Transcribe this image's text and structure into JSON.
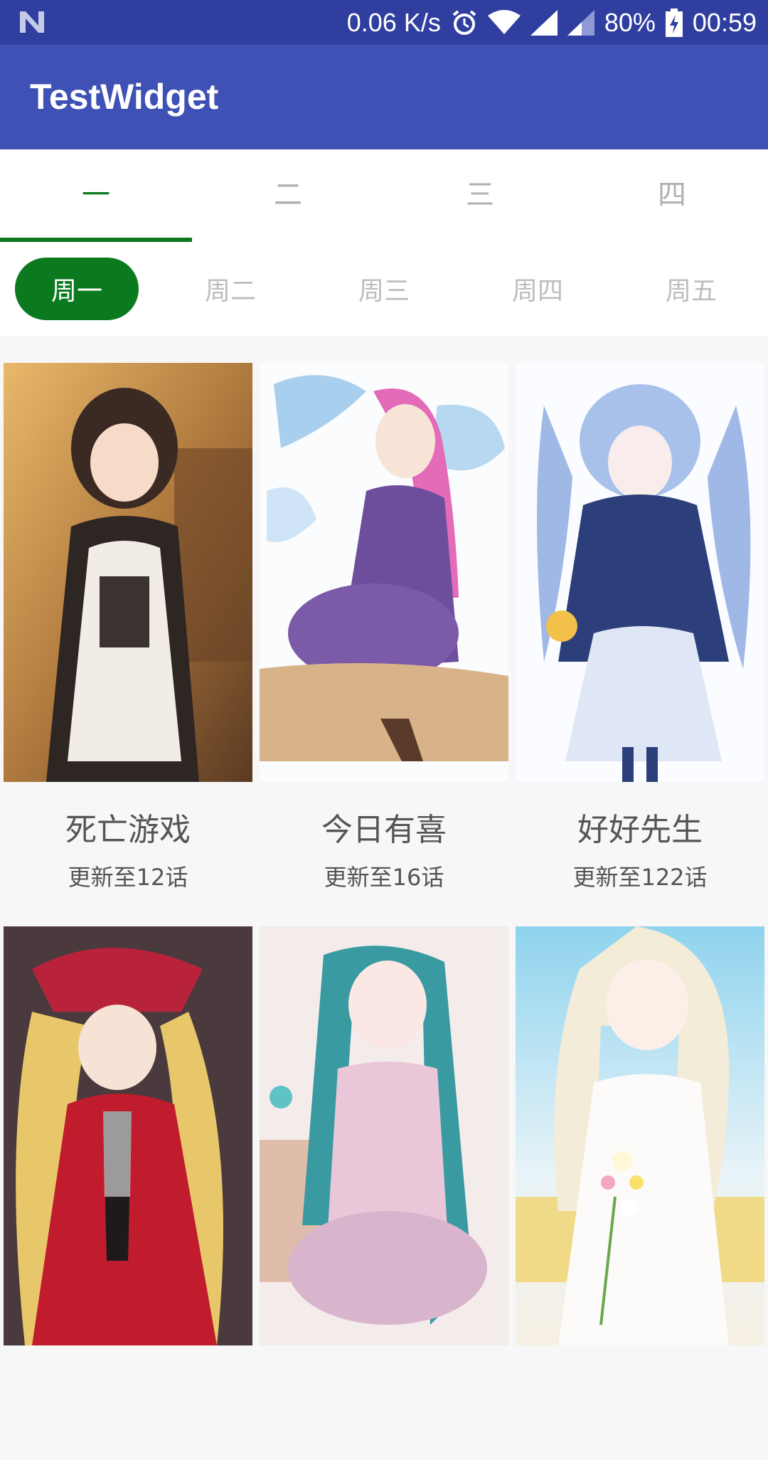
{
  "status_bar": {
    "speed": "0.06 K/s",
    "battery": "80%",
    "time": "00:59",
    "icons": [
      "n-logo-icon",
      "alarm-icon",
      "wifi-icon",
      "signal-icon",
      "signal-weak-icon",
      "battery-charging-icon"
    ]
  },
  "app_bar": {
    "title": "TestWidget",
    "color": "#3f51b5"
  },
  "tabs": [
    {
      "label": "一"
    },
    {
      "label": "二"
    },
    {
      "label": "三"
    },
    {
      "label": "四"
    }
  ],
  "days": [
    {
      "label": "周一"
    },
    {
      "label": "周二"
    },
    {
      "label": "周三"
    },
    {
      "label": "周四"
    },
    {
      "label": "周五"
    }
  ],
  "accent_color": "#0b7a1f",
  "cards": [
    {
      "title": "死亡游戏",
      "subtitle": "更新至12话"
    },
    {
      "title": "今日有喜",
      "subtitle": "更新至16话"
    },
    {
      "title": "好好先生",
      "subtitle": "更新至122话"
    },
    {
      "title": "",
      "subtitle": ""
    },
    {
      "title": "",
      "subtitle": ""
    },
    {
      "title": "",
      "subtitle": ""
    }
  ]
}
